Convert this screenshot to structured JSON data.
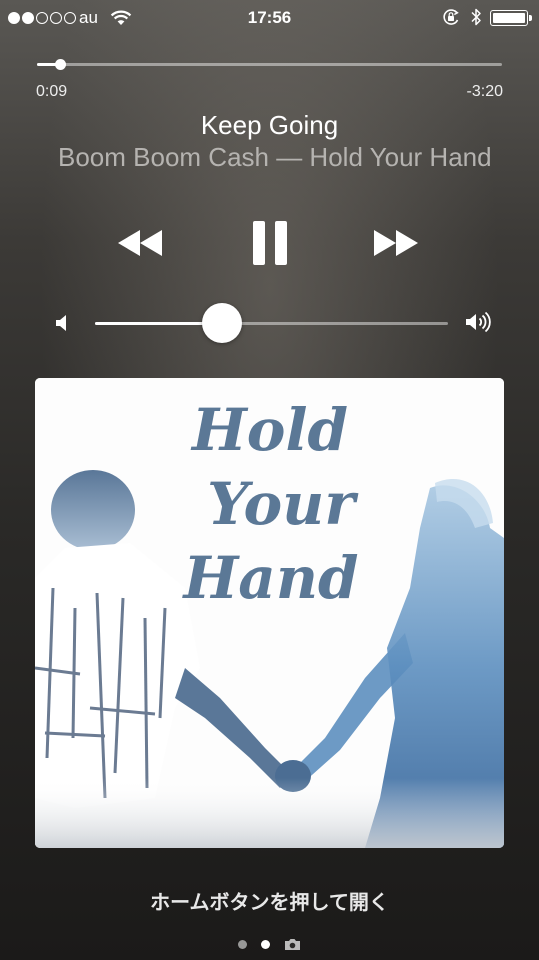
{
  "status_bar": {
    "signal_bars_filled": 2,
    "signal_bars_total": 5,
    "carrier": "au",
    "time": "17:56",
    "icons": [
      "wifi-icon",
      "orientation-lock-icon",
      "bluetooth-icon",
      "battery-icon"
    ]
  },
  "player": {
    "elapsed": "0:09",
    "remaining": "-3:20",
    "progress_fraction": 0.05,
    "song_title": "Keep Going",
    "artist_album": "Boom Boom Cash — Hold Your Hand",
    "controls": [
      "rewind-icon",
      "pause-icon",
      "fast-forward-icon"
    ],
    "volume_fraction": 0.36
  },
  "artwork": {
    "title_lines": [
      "Hold",
      "Your",
      "Hand"
    ],
    "accent_color": "#5b7896"
  },
  "lock_screen": {
    "unlock_hint": "ホームボタンを押して開く",
    "pages": 2,
    "active_page": 1
  }
}
